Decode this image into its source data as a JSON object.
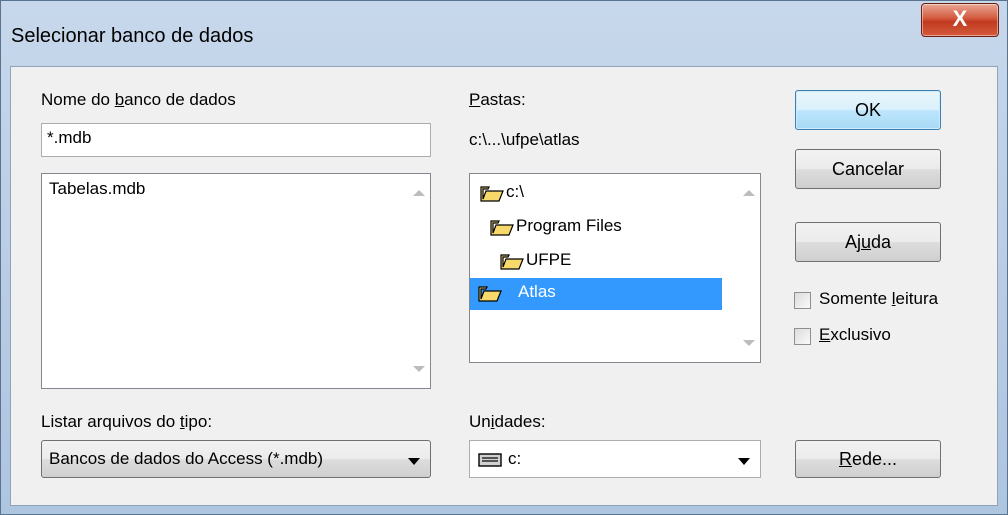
{
  "window": {
    "title": "Selecionar banco de dados",
    "close_glyph": "X"
  },
  "database_name": {
    "label_pre": "Nome do ",
    "label_mnemonic": "b",
    "label_post": "anco de dados",
    "value": "*.mdb"
  },
  "files": [
    "Tabelas.mdb"
  ],
  "folders": {
    "label_mnemonic": "P",
    "label_post": "astas:",
    "current_path": "c:\\...\\ufpe\\atlas",
    "tree": [
      {
        "name": "c:\\",
        "state": "open",
        "selected": false
      },
      {
        "name": "Program Files",
        "state": "open",
        "selected": false
      },
      {
        "name": "UFPE",
        "state": "open",
        "selected": false
      },
      {
        "name": "Atlas",
        "state": "open",
        "selected": true
      }
    ]
  },
  "buttons": {
    "ok": "OK",
    "cancel": "Cancelar",
    "help_pre": "Aj",
    "help_mnemonic": "u",
    "help_post": "da",
    "network_mnemonic": "R",
    "network_post": "ede..."
  },
  "options": {
    "read_only_pre": "Somente ",
    "read_only_mnemonic": "l",
    "read_only_post": "eitura",
    "read_only_checked": false,
    "exclusive_mnemonic": "E",
    "exclusive_post": "xclusivo",
    "exclusive_checked": false
  },
  "file_type": {
    "label_pre": "Listar arquivos do ",
    "label_mnemonic": "t",
    "label_post": "ipo:",
    "value": "Bancos de dados do Access (*.mdb)"
  },
  "drives": {
    "label_pre": "Un",
    "label_mnemonic": "i",
    "label_post": "dades:",
    "value": "c:",
    "icon": "drive-icon"
  },
  "colors": {
    "selection": "#3399ff",
    "folder_fill": "#f7d86a",
    "folder_stroke": "#000000"
  }
}
